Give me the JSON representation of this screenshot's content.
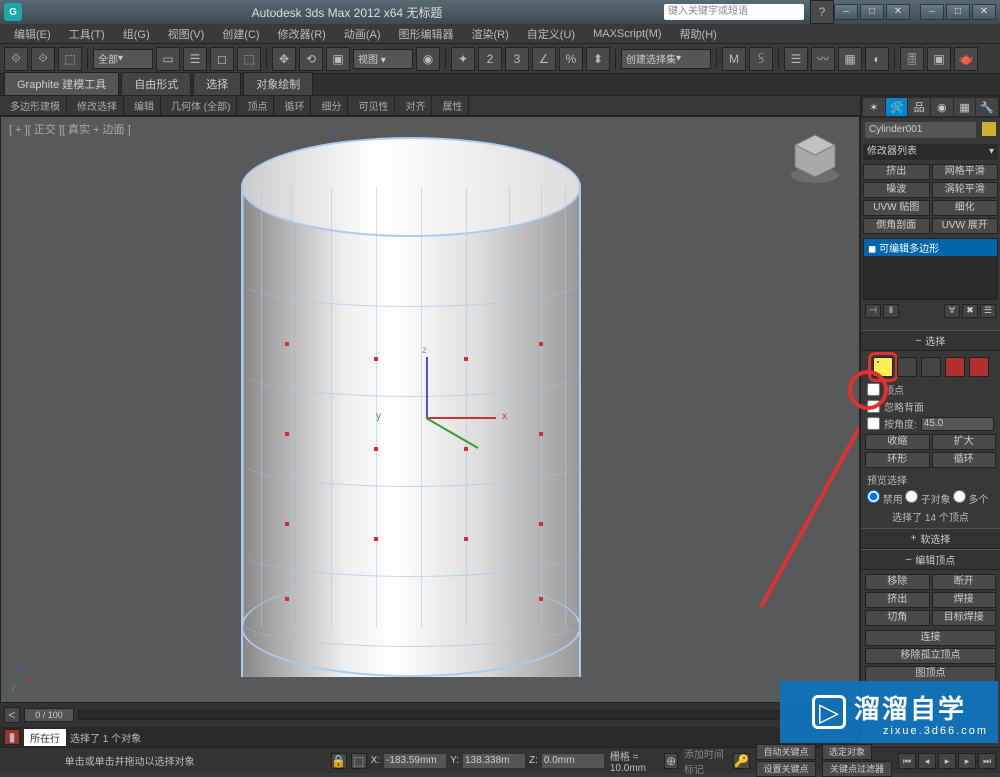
{
  "titlebar": {
    "app_icon": "G",
    "title": "Autodesk 3ds Max 2012 x64    无标题",
    "search_placeholder": "键入关键字或短语",
    "win_buttons": [
      "–",
      "□",
      "✕"
    ]
  },
  "menubar": {
    "items": [
      "编辑(E)",
      "工具(T)",
      "组(G)",
      "视图(V)",
      "创建(C)",
      "修改器(R)",
      "动画(A)",
      "图形编辑器",
      "渲染(R)",
      "自定义(U)",
      "MAXScript(M)",
      "帮助(H)"
    ]
  },
  "toolbar": {
    "selset_label": "全部",
    "named_selset": "创建选择集"
  },
  "ribbon": {
    "tabs": [
      "Graphite 建模工具",
      "自由形式",
      "选择",
      "对象绘制"
    ],
    "subtabs": [
      "多边形建模",
      "修改选择",
      "编辑",
      "几何体 (全部)",
      "顶点",
      "循环",
      "细分",
      "可见性",
      "对齐",
      "属性"
    ]
  },
  "viewport": {
    "label": "[ + ][ 正交 ][ 真实 + 边面 ]"
  },
  "gizmo": {
    "x": "x",
    "y": "y",
    "z": "z"
  },
  "right_panel": {
    "object_name": "Cylinder001",
    "modifier_combo": "修改器列表",
    "buttons_row1": [
      "挤出",
      "网格平滑",
      "噪波",
      "涡轮平滑",
      "UVW 贴图",
      "细化",
      "倒角剖面",
      "UVW 展开"
    ],
    "stack_item": "可编辑多边形",
    "rollout_select": "选择",
    "ignore_back": "忽略背面",
    "by_angle": "按角度:",
    "angle_value": "45.0",
    "shrink": "收缩",
    "grow": "扩大",
    "ring": "环形",
    "loop": "循环",
    "preview_label": "预览选择",
    "radio_disable": "禁用",
    "radio_subobj": "子对象",
    "radio_multi": "多个",
    "selected_info": "选择了 14 个顶点",
    "rollout_soft": "软选择",
    "rollout_edit": "编辑顶点",
    "remove": "移除",
    "break": "断开",
    "extrude": "挤出",
    "weld": "焊接",
    "chamfer": "切角",
    "target_weld": "目标焊接",
    "connect": "连接",
    "remove_iso": "移除孤立顶点",
    "remove_map": "图顶点"
  },
  "timeline": {
    "pos": "0 / 100"
  },
  "trackbar": {
    "now": "所在行",
    "sel_info": "选择了 1 个对象",
    "prompt": "单击或单击并拖动以选择对象",
    "add_time": "添加时间标记"
  },
  "statusbar": {
    "x_label": "X:",
    "x_val": "-183.59mm",
    "y_label": "Y:",
    "y_val": "138.338m",
    "z_label": "Z:",
    "z_val": "0.0mm",
    "grid": "栅格 = 10.0mm",
    "autokey": "自动关键点",
    "selkey": "选定对象",
    "setkey": "设置关键点",
    "keyfilter": "关键点过滤器"
  },
  "watermark": {
    "main": "溜溜自学",
    "sub": "zixue.3d66.com",
    "play": "▷"
  }
}
